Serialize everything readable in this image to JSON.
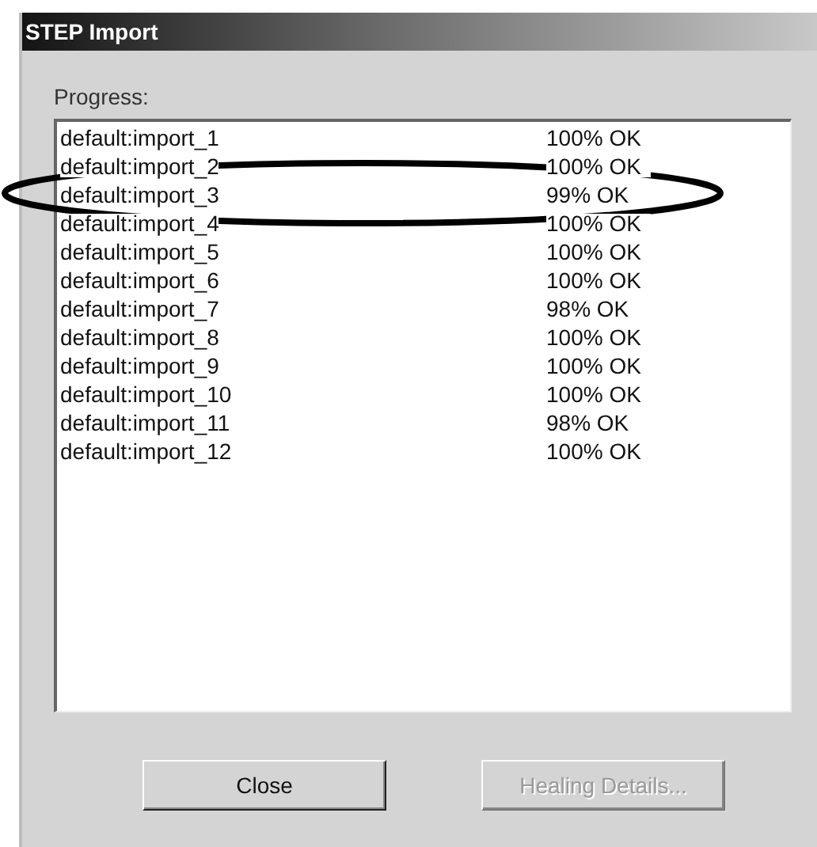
{
  "window": {
    "title": "STEP Import"
  },
  "progress_label": "Progress:",
  "rows": [
    {
      "name": "default:import_1",
      "status": "100% OK",
      "highlighted": false
    },
    {
      "name": "default:import_2",
      "status": "100% OK",
      "highlighted": false
    },
    {
      "name": "default:import_3",
      "status": "99% OK",
      "highlighted": true
    },
    {
      "name": "default:import_4",
      "status": "100% OK",
      "highlighted": false
    },
    {
      "name": "default:import_5",
      "status": "100% OK",
      "highlighted": false
    },
    {
      "name": "default:import_6",
      "status": "100% OK",
      "highlighted": false
    },
    {
      "name": "default:import_7",
      "status": "98% OK",
      "highlighted": false
    },
    {
      "name": "default:import_8",
      "status": "100% OK",
      "highlighted": false
    },
    {
      "name": "default:import_9",
      "status": "100% OK",
      "highlighted": false
    },
    {
      "name": "default:import_10",
      "status": "100% OK",
      "highlighted": false
    },
    {
      "name": "default:import_11",
      "status": "98% OK",
      "highlighted": false
    },
    {
      "name": "default:import_12",
      "status": "100% OK",
      "highlighted": false
    }
  ],
  "buttons": [
    {
      "label": "Close",
      "disabled": false
    },
    {
      "label": "Healing Details...",
      "disabled": true
    }
  ]
}
